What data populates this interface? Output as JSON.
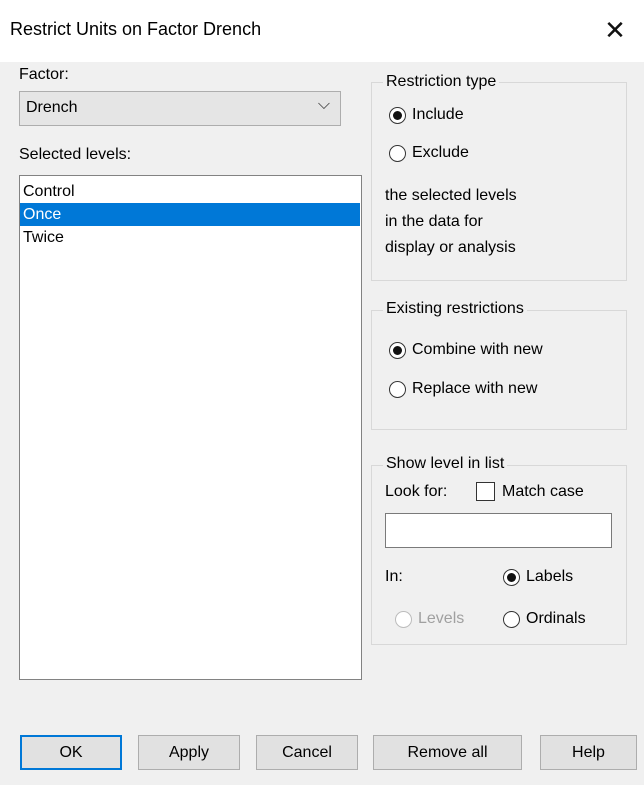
{
  "window": {
    "title": "Restrict Units on Factor Drench",
    "close_glyph": "✕"
  },
  "factor": {
    "label": "Factor:",
    "selected": "Drench",
    "arrow_glyph": "⌵"
  },
  "levels": {
    "label": "Selected levels:",
    "items": [
      {
        "text": "Control",
        "selected": false
      },
      {
        "text": "Once",
        "selected": true
      },
      {
        "text": "Twice",
        "selected": false
      }
    ]
  },
  "restriction_type": {
    "caption": "Restriction type",
    "include": "Include",
    "exclude": "Exclude",
    "selected": "Include",
    "note_lines": [
      "the selected levels",
      "in the data for",
      "display or analysis"
    ]
  },
  "existing_restrictions": {
    "caption": "Existing restrictions",
    "combine": "Combine with new",
    "replace": "Replace with new",
    "selected": "Combine with new"
  },
  "show_level": {
    "caption": "Show level in list",
    "look_for": "Look for:",
    "match_case": "Match case",
    "match_case_checked": false,
    "search_value": "",
    "in_label": "In:",
    "labels": "Labels",
    "levels": "Levels",
    "ordinals": "Ordinals",
    "selected": "Labels",
    "levels_enabled": false
  },
  "buttons": {
    "ok": "OK",
    "apply": "Apply",
    "cancel": "Cancel",
    "remove_all": "Remove all",
    "help": "Help"
  }
}
